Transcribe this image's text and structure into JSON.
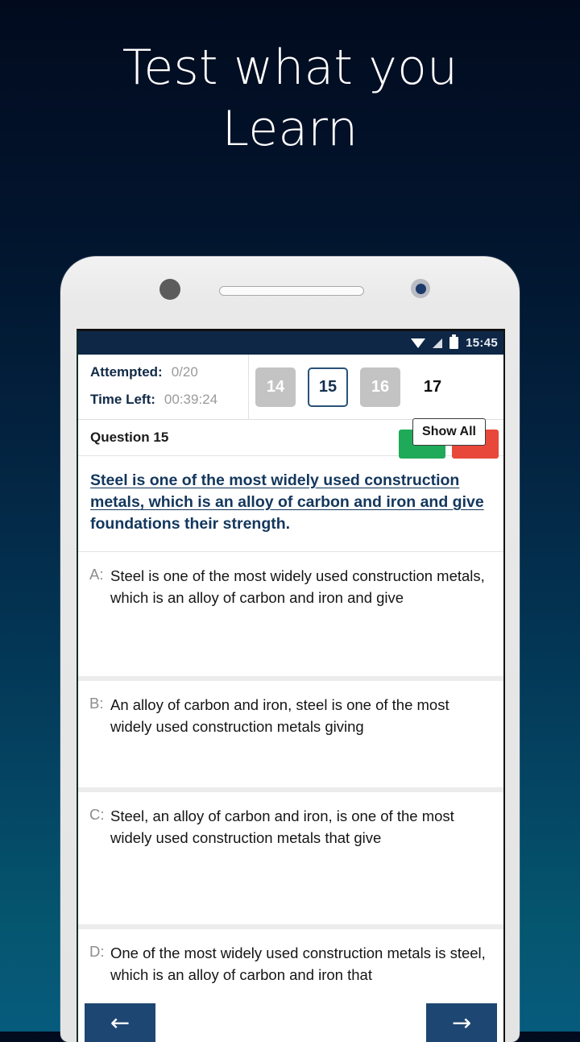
{
  "promo": {
    "line1": "Test what you",
    "line2": "Learn"
  },
  "statusbar": {
    "time": "15:45",
    "icons": [
      "wifi-icon",
      "cellular-signal-icon",
      "battery-icon"
    ]
  },
  "quiz": {
    "stats": [
      {
        "label": "Attempted:",
        "value": "0/20"
      },
      {
        "label": "Time Left:",
        "value": "00:39:24"
      }
    ],
    "question_nav": [
      {
        "number": "14",
        "state": "dim"
      },
      {
        "number": "15",
        "state": "current"
      },
      {
        "number": "16",
        "state": "dim"
      },
      {
        "number": "17",
        "state": "plain"
      }
    ],
    "question_title": "Question 15",
    "show_all_label": "Show All",
    "action_buttons": [
      {
        "name": "mark-correct-button",
        "color": "#1faa59"
      },
      {
        "name": "mark-wrong-button",
        "color": "#e8483a"
      }
    ],
    "question_text_underlined": "Steel is one of the most widely used construction metals, which is an alloy of carbon and iron and give ",
    "question_text_plain": "foundations their strength.",
    "options": [
      {
        "letter": "A:",
        "text": "Steel is one of the most widely used construction metals, which is an alloy of carbon and iron and give"
      },
      {
        "letter": "B:",
        "text": "An alloy of carbon and iron, steel is one of the most widely used construction metals giving"
      },
      {
        "letter": "C:",
        "text": "Steel, an alloy of carbon and iron, is one of the most widely used construction metals that give"
      },
      {
        "letter": "D:",
        "text": "One of the most widely used construction metals is steel, which is an alloy of carbon and iron that"
      }
    ],
    "nav": {
      "prev_arrow": "←",
      "next_arrow": "→"
    }
  },
  "colors": {
    "brand_navy": "#13375d",
    "accent_green": "#1faa59",
    "accent_red": "#e8483a",
    "nav_button": "#1e4672"
  }
}
